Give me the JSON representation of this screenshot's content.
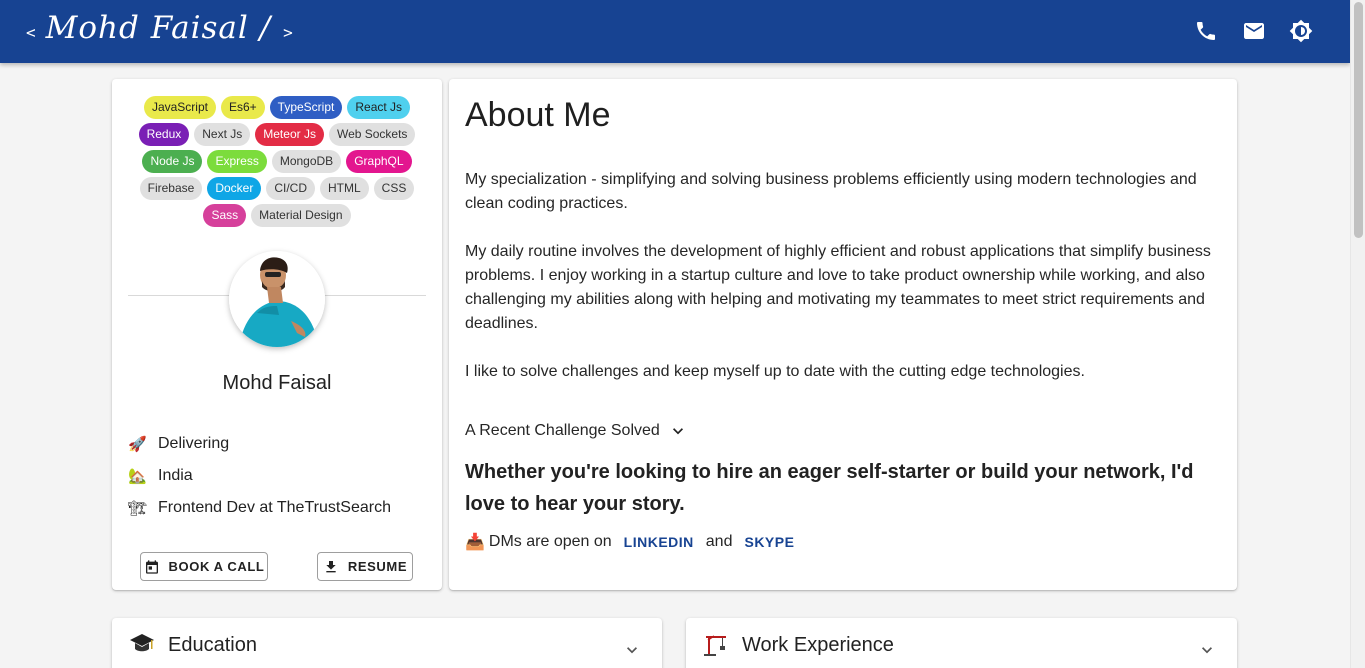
{
  "header": {
    "brand_prefix": "<",
    "brand_name": "Mohd Faisal /",
    "brand_suffix": ">",
    "bg_color": "#174392",
    "icons": [
      "phone-icon",
      "mail-icon",
      "theme-toggle-icon"
    ]
  },
  "profile": {
    "skills": [
      {
        "label": "JavaScript",
        "bg": "#e9e94a",
        "fg": "#222"
      },
      {
        "label": "Es6+",
        "bg": "#e9e94a",
        "fg": "#222"
      },
      {
        "label": "TypeScript",
        "bg": "#2f5ec4",
        "fg": "#fff"
      },
      {
        "label": "React Js",
        "bg": "#4fd0ee",
        "fg": "#222"
      },
      {
        "label": "Redux",
        "bg": "#7a1fb5",
        "fg": "#fff"
      },
      {
        "label": "Next Js",
        "bg": "#e0e0e0",
        "fg": "#333"
      },
      {
        "label": "Meteor Js",
        "bg": "#e32c45",
        "fg": "#fff"
      },
      {
        "label": "Web Sockets",
        "bg": "#e0e0e0",
        "fg": "#333"
      },
      {
        "label": "Node Js",
        "bg": "#4caf50",
        "fg": "#fff"
      },
      {
        "label": "Express",
        "bg": "#7cdc3c",
        "fg": "#fff"
      },
      {
        "label": "MongoDB",
        "bg": "#e0e0e0",
        "fg": "#333"
      },
      {
        "label": "GraphQL",
        "bg": "#e3168f",
        "fg": "#fff"
      },
      {
        "label": "Firebase",
        "bg": "#e0e0e0",
        "fg": "#333"
      },
      {
        "label": "Docker",
        "bg": "#0fa6e6",
        "fg": "#fff"
      },
      {
        "label": "CI/CD",
        "bg": "#e0e0e0",
        "fg": "#333"
      },
      {
        "label": "HTML",
        "bg": "#e0e0e0",
        "fg": "#333"
      },
      {
        "label": "CSS",
        "bg": "#e0e0e0",
        "fg": "#333"
      },
      {
        "label": "Sass",
        "bg": "#d6409b",
        "fg": "#fff"
      },
      {
        "label": "Material Design",
        "bg": "#e0e0e0",
        "fg": "#333"
      }
    ],
    "name": "Mohd Faisal",
    "facts": [
      {
        "emoji": "🚀",
        "text": "Delivering"
      },
      {
        "emoji": "🏡",
        "text": "India"
      },
      {
        "emoji": "🏗",
        "text": "Frontend Dev at TheTrustSearch"
      }
    ],
    "book_call_label": "BOOK A CALL",
    "resume_label": "RESUME"
  },
  "about": {
    "title": "About Me",
    "paragraphs": [
      "My specialization - simplifying and solving business problems efficiently using modern technologies and clean coding practices.",
      "My daily routine involves the development of highly efficient and robust applications that simplify business problems. I enjoy working in a startup culture and love to take product ownership while working, and also challenging my abilities along with helping and motivating my teammates to meet strict requirements and deadlines.",
      "I like to solve challenges and keep myself up to date with the cutting edge technologies."
    ],
    "challenge_label": "A Recent Challenge Solved",
    "hire_text": "Whether you're looking to hire an eager self-starter or build your network, I'd love to hear your story.",
    "dm_emoji": "📥",
    "dm_text": "DMs are open on",
    "linkedin_label": "LINKEDIN",
    "and_text": "and",
    "skype_label": "SKYPE"
  },
  "sections": {
    "education": {
      "title": "Education",
      "icon": "graduation-cap-icon"
    },
    "work": {
      "title": "Work Experience",
      "icon": "construction-crane-icon"
    }
  }
}
